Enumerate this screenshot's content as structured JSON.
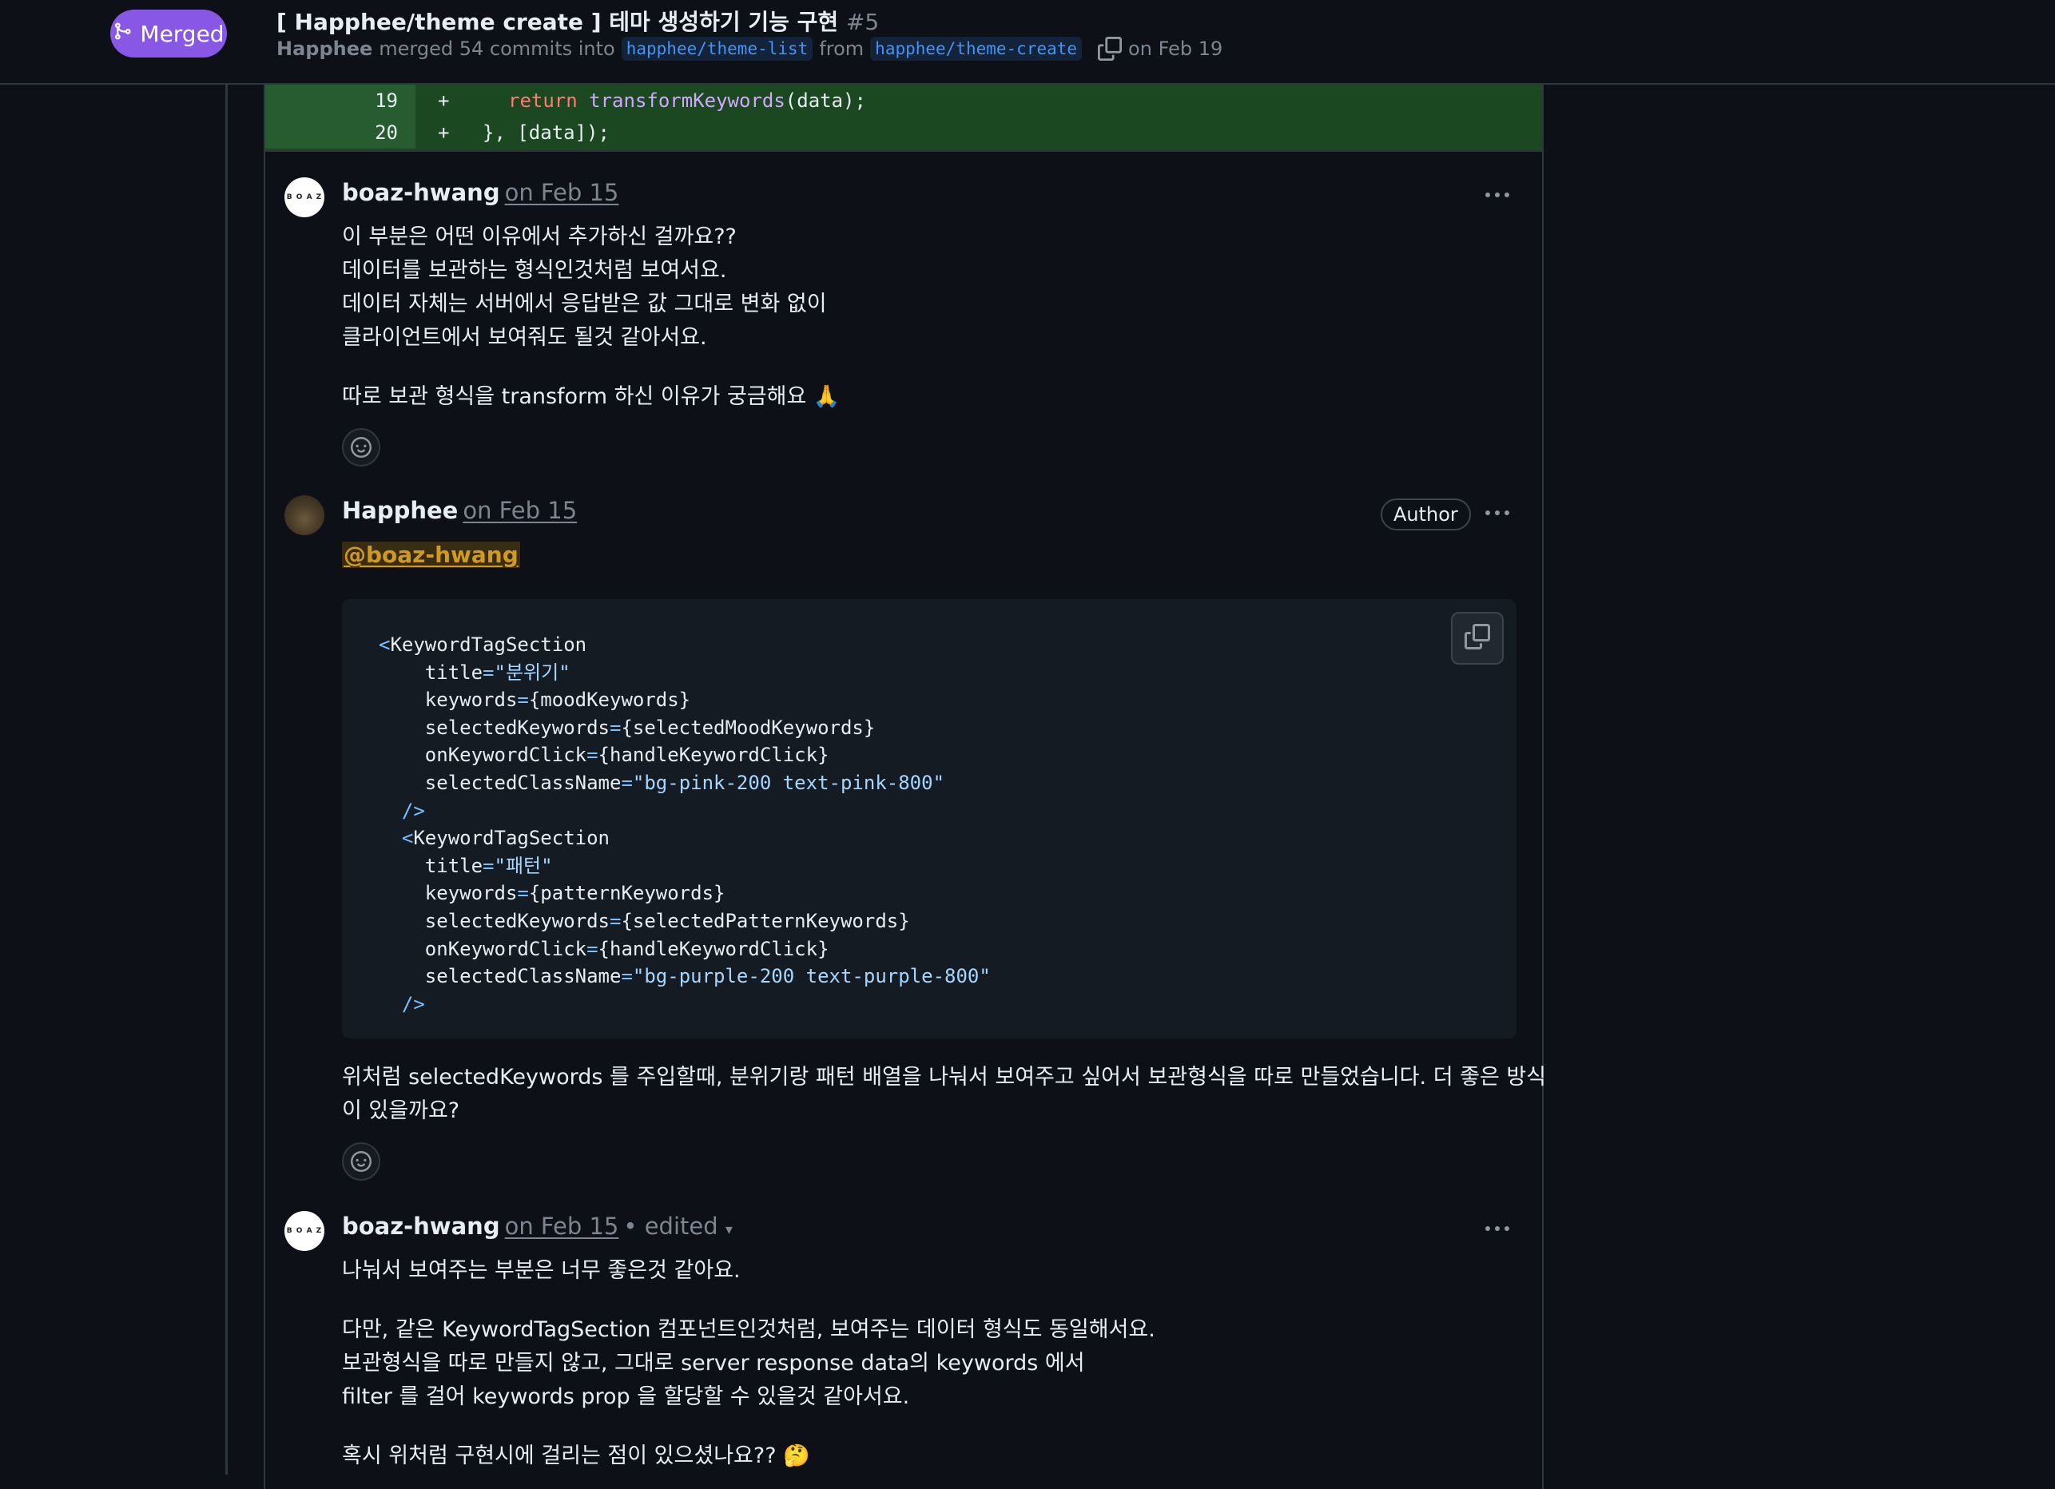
{
  "header": {
    "status_badge": "Merged",
    "title": "[ Happhee/theme create ] 테마 생성하기 기능 구현",
    "number": "#5",
    "merger": "Happhee",
    "merge_text": "merged 54 commits into",
    "base_branch": "happhee/theme-list",
    "from_text": "from",
    "head_branch": "happhee/theme-create",
    "date": "on Feb 19"
  },
  "diff": {
    "lines": [
      {
        "num": "19",
        "sign": "+",
        "code_kw": "return",
        "code_fn": "transformKeywords",
        "code_rest": "(data);"
      },
      {
        "num": "20",
        "sign": "+",
        "code": "}, [data]);"
      }
    ]
  },
  "comments": [
    {
      "author": "boaz-hwang",
      "date": "on Feb 15",
      "avatar_text": "B O A Z",
      "body": "이 부분은 어떤 이유에서 추가하신 걸까요??\n데이터를 보관하는 형식인것처럼 보여서요.\n데이터 자체는 서버에서 응답받은 값 그대로 변화 없이\n클라이언트에서 보여줘도 될것 같아서요.",
      "body2": "따로 보관 형식을 transform 하신 이유가 궁금해요 🙏"
    },
    {
      "author": "Happhee",
      "date": "on Feb 15",
      "badge": "Author",
      "mention": "@boaz-hwang",
      "body": "위처럼 selectedKeywords 를 주입할때, 분위기랑 패턴 배열을 나눠서 보여주고 싶어서 보관형식을 따로 만들었습니다. 더 좋은 방식\n이 있을까요?"
    },
    {
      "author": "boaz-hwang",
      "date": "on Feb 15",
      "edited": "• edited",
      "avatar_text": "B O A Z",
      "body": "나눠서 보여주는 부분은 너무 좋은것 같아요.",
      "body2": "다만, 같은 KeywordTagSection 컴포넌트인것처럼, 보여주는 데이터 형식도 동일해서요.\n보관형식을 따로 만들지 않고, 그대로 server response data의 keywords 에서\nfilter 를 걸어 keywords prop 을 할당할 수 있을것 같아서요.",
      "body3": "혹시 위처럼 구현시에 걸리는 점이 있으셨나요?? 🤔"
    }
  ],
  "code": {
    "lines": [
      {
        "indent": "",
        "tag": "<KeywordTagSection"
      },
      {
        "indent": "    ",
        "attr": "title",
        "val": "\"분위기\""
      },
      {
        "indent": "    ",
        "attr": "keywords",
        "val_plain": "{moodKeywords}"
      },
      {
        "indent": "    ",
        "attr": "selectedKeywords",
        "val_plain": "{selectedMoodKeywords}"
      },
      {
        "indent": "    ",
        "attr": "onKeywordClick",
        "val_plain": "{handleKeywordClick}"
      },
      {
        "indent": "    ",
        "attr": "selectedClassName",
        "val": "\"bg-pink-200 text-pink-800\""
      },
      {
        "indent": "  ",
        "close": "/>"
      },
      {
        "indent": "  ",
        "tag": "<KeywordTagSection"
      },
      {
        "indent": "    ",
        "attr": "title",
        "val": "\"패턴\""
      },
      {
        "indent": "    ",
        "attr": "keywords",
        "val_plain": "{patternKeywords}"
      },
      {
        "indent": "    ",
        "attr": "selectedKeywords",
        "val_plain": "{selectedPatternKeywords}"
      },
      {
        "indent": "    ",
        "attr": "onKeywordClick",
        "val_plain": "{handleKeywordClick}"
      },
      {
        "indent": "    ",
        "attr": "selectedClassName",
        "val": "\"bg-purple-200 text-purple-800\""
      },
      {
        "indent": "  ",
        "close": "/>"
      }
    ]
  },
  "icons": {
    "merge": "git-merge-icon",
    "copy": "copy-icon",
    "more": "kebab-horizontal-icon",
    "reaction": "smiley-icon",
    "caret": "triangle-down-icon"
  },
  "colors": {
    "merged_purple": "#8957e5",
    "link_blue": "#4493f8",
    "mention_gold": "#d29922",
    "diff_added_bg": "#1b4721"
  }
}
